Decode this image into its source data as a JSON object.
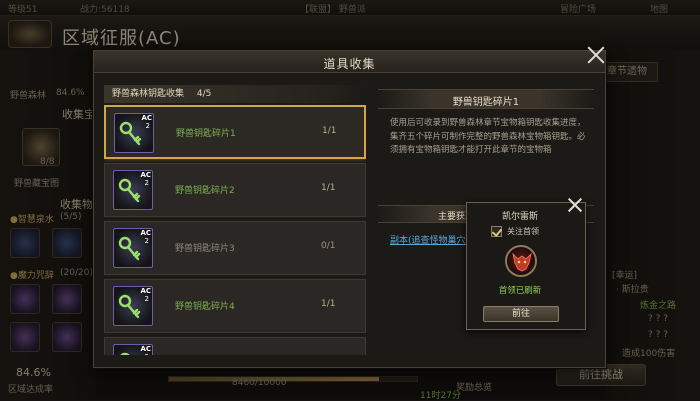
{
  "background": {
    "topbar": {
      "left": "等级51",
      "power": "战力:56118",
      "guild": "【联盟】 野兽派",
      "right1": "冒险广场",
      "right2": "地图"
    },
    "title": "区域征服(AC)",
    "left": {
      "forest_label": "野兽森林",
      "forest_pct": "84.6%",
      "collect_label1": "收集宝",
      "item_label": "野兽藏宝图",
      "item_count": "8/8",
      "collect_label2": "收集物",
      "wisdom_label": "●智慧泉水",
      "wisdom_count": "(5/5)",
      "magic_label": "●魔力咒辞",
      "magic_count": "(20/20)",
      "area_pct": "84.6%",
      "area_label": "区域达成率"
    },
    "right": {
      "top_button": "章节遗物",
      "luck_label": "[幸运]",
      "luck_sub": "· 斯拉贵",
      "path_label": "炼金之路",
      "q1": "? ? ?",
      "q2": "? ? ?",
      "damage_label": "造成100伤害",
      "challenge_button": "前往挑战"
    },
    "bottom": {
      "progress_text": "8460/10000",
      "progress_pct": 0.846,
      "time_text": "11时27分",
      "reward_label": "奖励总览"
    }
  },
  "modal": {
    "title": "道具收集",
    "collection_header": "野兽森林钥匙收集",
    "collection_progress": "4/5",
    "items": [
      {
        "name": "野兽钥匙碎片1",
        "count": "1/1",
        "badge": "AC",
        "badge_num": "2",
        "selected": true
      },
      {
        "name": "野兽钥匙碎片2",
        "count": "1/1",
        "badge": "AC",
        "badge_num": "2",
        "selected": false
      },
      {
        "name": "野兽钥匙碎片3",
        "count": "0/1",
        "badge": "AC",
        "badge_num": "2",
        "selected": false
      },
      {
        "name": "野兽钥匙碎片4",
        "count": "1/1",
        "badge": "AC",
        "badge_num": "2",
        "selected": false
      },
      {
        "name": "",
        "count": "",
        "badge": "AC",
        "badge_num": "2",
        "selected": false
      }
    ],
    "detail": {
      "title": "野兽钥匙碎片1",
      "description": "使用后可收录到野兽森林章节宝物箱钥匙收集进度，集齐五个碎片可制作完整的野兽森林宝物箱钥匙。必须拥有宝物箱钥匙才能打开此章节的宝物箱",
      "source_title": "主要获取途径",
      "source_link": "副本(追查怪物巢穴)"
    }
  },
  "boss_popup": {
    "name": "凯尔雷斯",
    "follow_label": "关注首领",
    "follow_checked": true,
    "status": "首领已刷新",
    "goto_button": "前往"
  },
  "colors": {
    "accent_gold": "#d4a545",
    "item_green": "#7fb04f",
    "link_blue": "#5aa7d6",
    "status_green": "#8fd24f"
  }
}
